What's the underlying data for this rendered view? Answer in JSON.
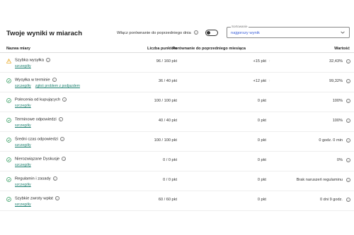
{
  "header": {
    "title": "Twoje wyniki w miarach",
    "compare_label": "Włącz porównanie do poprzedniego dnia",
    "compare_enabled": false,
    "sort_legend": "Sortowanie",
    "sort_value": "najgorszy wynik"
  },
  "table": {
    "columns": {
      "name": "Nazwa miary",
      "points": "Liczba punktów",
      "compare": "Porównanie do poprzedniego miesiąca",
      "value": "Wartość"
    },
    "rows": [
      {
        "status": "warning",
        "name": "Szybka wysyłka",
        "links": [
          "szczegóły"
        ],
        "points": "96 / 160 pkt",
        "compare": "+15 pkt",
        "arrow": "↑",
        "value": "32,43%"
      },
      {
        "status": "ok",
        "name": "Wysyłka w terminie",
        "links": [
          "szczegóły",
          "zgłoś problem z podjazdem"
        ],
        "points": "36 / 40 pkt",
        "compare": "+12 pkt",
        "arrow": "↑",
        "value": "99,32%"
      },
      {
        "status": "ok",
        "name": "Polecenia od kupujących",
        "links": [
          "szczegóły"
        ],
        "points": "100 / 100 pkt",
        "compare": "0 pkt",
        "arrow": "",
        "value": "100%"
      },
      {
        "status": "ok",
        "name": "Terminowe odpowiedzi",
        "links": [
          "szczegóły"
        ],
        "points": "40 / 40 pkt",
        "compare": "0 pkt",
        "arrow": "",
        "value": "100%"
      },
      {
        "status": "ok",
        "name": "Średni czas odpowiedzi",
        "links": [
          "szczegóły"
        ],
        "points": "100 / 100 pkt",
        "compare": "0 pkt",
        "arrow": "",
        "value": "0 godz. 0 min"
      },
      {
        "status": "ok",
        "name": "Nierozwiązane Dyskusje",
        "links": [
          "szczegóły"
        ],
        "points": "0 / 0 pkt",
        "compare": "0 pkt",
        "arrow": "",
        "value": "0%"
      },
      {
        "status": "ok",
        "name": "Regulamin i zasady",
        "links": [
          "szczegóły"
        ],
        "points": "0 / 0 pkt",
        "compare": "0 pkt",
        "arrow": "",
        "value": "Brak naruszeń regulaminu"
      },
      {
        "status": "ok",
        "name": "Szybkie zwroty wpłat",
        "links": [
          "szczegóły"
        ],
        "points": "60 / 60 pkt",
        "compare": "0 pkt",
        "arrow": "",
        "value": "0 dni 9 godz."
      }
    ]
  },
  "colors": {
    "ok": "#2e9a5c",
    "warning": "#e8a317",
    "link": "#1a7f6e",
    "accent": "#3a5ed8"
  },
  "icons": {
    "ok": "check-circle-icon",
    "warning": "warning-triangle-icon",
    "info": "info-icon",
    "chevron": "chevron-down-icon",
    "arrow": "arrow-up-icon"
  }
}
